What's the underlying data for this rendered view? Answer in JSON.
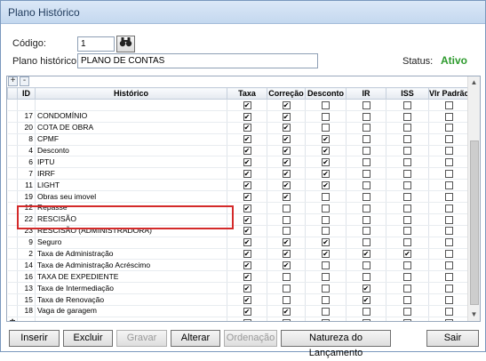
{
  "window": {
    "title": "Plano Histórico"
  },
  "form": {
    "codigo_label": "Código:",
    "codigo_value": "1",
    "plano_label": "Plano histórico:",
    "plano_value": "PLANO DE CONTAS",
    "status_label": "Status:",
    "status_value": "Ativo",
    "search_icon": "binoculars-icon"
  },
  "toolbar": {
    "add": "+",
    "remove": "-"
  },
  "grid": {
    "columns": [
      "ID",
      "Histórico",
      "Taxa",
      "Correção",
      "Desconto",
      "IR",
      "ISS",
      "Vlr Padrão"
    ],
    "new_row_marker": "✱",
    "rows": [
      {
        "id": "",
        "hist": "",
        "taxa": true,
        "corr": true,
        "desc": false,
        "ir": false,
        "iss": false,
        "vlr": false
      },
      {
        "id": "17",
        "hist": "CONDOMÍNIO",
        "taxa": true,
        "corr": true,
        "desc": false,
        "ir": false,
        "iss": false,
        "vlr": false
      },
      {
        "id": "20",
        "hist": "COTA DE OBRA",
        "taxa": true,
        "corr": true,
        "desc": false,
        "ir": false,
        "iss": false,
        "vlr": false
      },
      {
        "id": "8",
        "hist": "CPMF",
        "taxa": true,
        "corr": true,
        "desc": true,
        "ir": false,
        "iss": false,
        "vlr": false
      },
      {
        "id": "4",
        "hist": "Desconto",
        "taxa": true,
        "corr": true,
        "desc": true,
        "ir": false,
        "iss": false,
        "vlr": false
      },
      {
        "id": "6",
        "hist": "IPTU",
        "taxa": true,
        "corr": true,
        "desc": true,
        "ir": false,
        "iss": false,
        "vlr": false
      },
      {
        "id": "7",
        "hist": "IRRF",
        "taxa": true,
        "corr": true,
        "desc": true,
        "ir": false,
        "iss": false,
        "vlr": false
      },
      {
        "id": "11",
        "hist": "LIGHT",
        "taxa": true,
        "corr": true,
        "desc": true,
        "ir": false,
        "iss": false,
        "vlr": false
      },
      {
        "id": "19",
        "hist": "Obras seu imovel",
        "taxa": true,
        "corr": true,
        "desc": false,
        "ir": false,
        "iss": false,
        "vlr": false
      },
      {
        "id": "12",
        "hist": "Repasse",
        "taxa": true,
        "corr": false,
        "desc": false,
        "ir": false,
        "iss": false,
        "vlr": false
      },
      {
        "id": "22",
        "hist": "RESCISÃO",
        "taxa": true,
        "corr": false,
        "desc": false,
        "ir": false,
        "iss": false,
        "vlr": false
      },
      {
        "id": "23",
        "hist": "RESCISÃO (ADMINISTRADORA)",
        "taxa": true,
        "corr": false,
        "desc": false,
        "ir": false,
        "iss": false,
        "vlr": false
      },
      {
        "id": "9",
        "hist": "Seguro",
        "taxa": true,
        "corr": true,
        "desc": true,
        "ir": false,
        "iss": false,
        "vlr": false
      },
      {
        "id": "2",
        "hist": "Taxa de Administração",
        "taxa": true,
        "corr": true,
        "desc": true,
        "ir": true,
        "iss": true,
        "vlr": false
      },
      {
        "id": "14",
        "hist": "Taxa de Administração Acréscimo",
        "taxa": true,
        "corr": true,
        "desc": false,
        "ir": false,
        "iss": false,
        "vlr": false
      },
      {
        "id": "16",
        "hist": "TAXA DE EXPEDIENTE",
        "taxa": true,
        "corr": false,
        "desc": false,
        "ir": false,
        "iss": false,
        "vlr": false
      },
      {
        "id": "13",
        "hist": "Taxa de Intermediação",
        "taxa": true,
        "corr": false,
        "desc": false,
        "ir": true,
        "iss": false,
        "vlr": false
      },
      {
        "id": "15",
        "hist": "Taxa de Renovação",
        "taxa": true,
        "corr": false,
        "desc": false,
        "ir": true,
        "iss": false,
        "vlr": false
      },
      {
        "id": "18",
        "hist": "Vaga de garagem",
        "taxa": true,
        "corr": true,
        "desc": false,
        "ir": false,
        "iss": false,
        "vlr": false
      },
      {
        "id": "",
        "hist": "",
        "taxa": false,
        "corr": false,
        "desc": false,
        "ir": false,
        "iss": false,
        "vlr": false,
        "new_row": true
      }
    ]
  },
  "buttons": {
    "inserir": "Inserir",
    "excluir": "Excluir",
    "gravar": "Gravar",
    "alterar": "Alterar",
    "ordenacao": "Ordenação",
    "natureza": "Natureza do Lançamento",
    "sair": "Sair"
  },
  "colors": {
    "status_active": "#2d9a2d",
    "highlight_border": "#d42a2a",
    "title_text": "#1e395b"
  }
}
